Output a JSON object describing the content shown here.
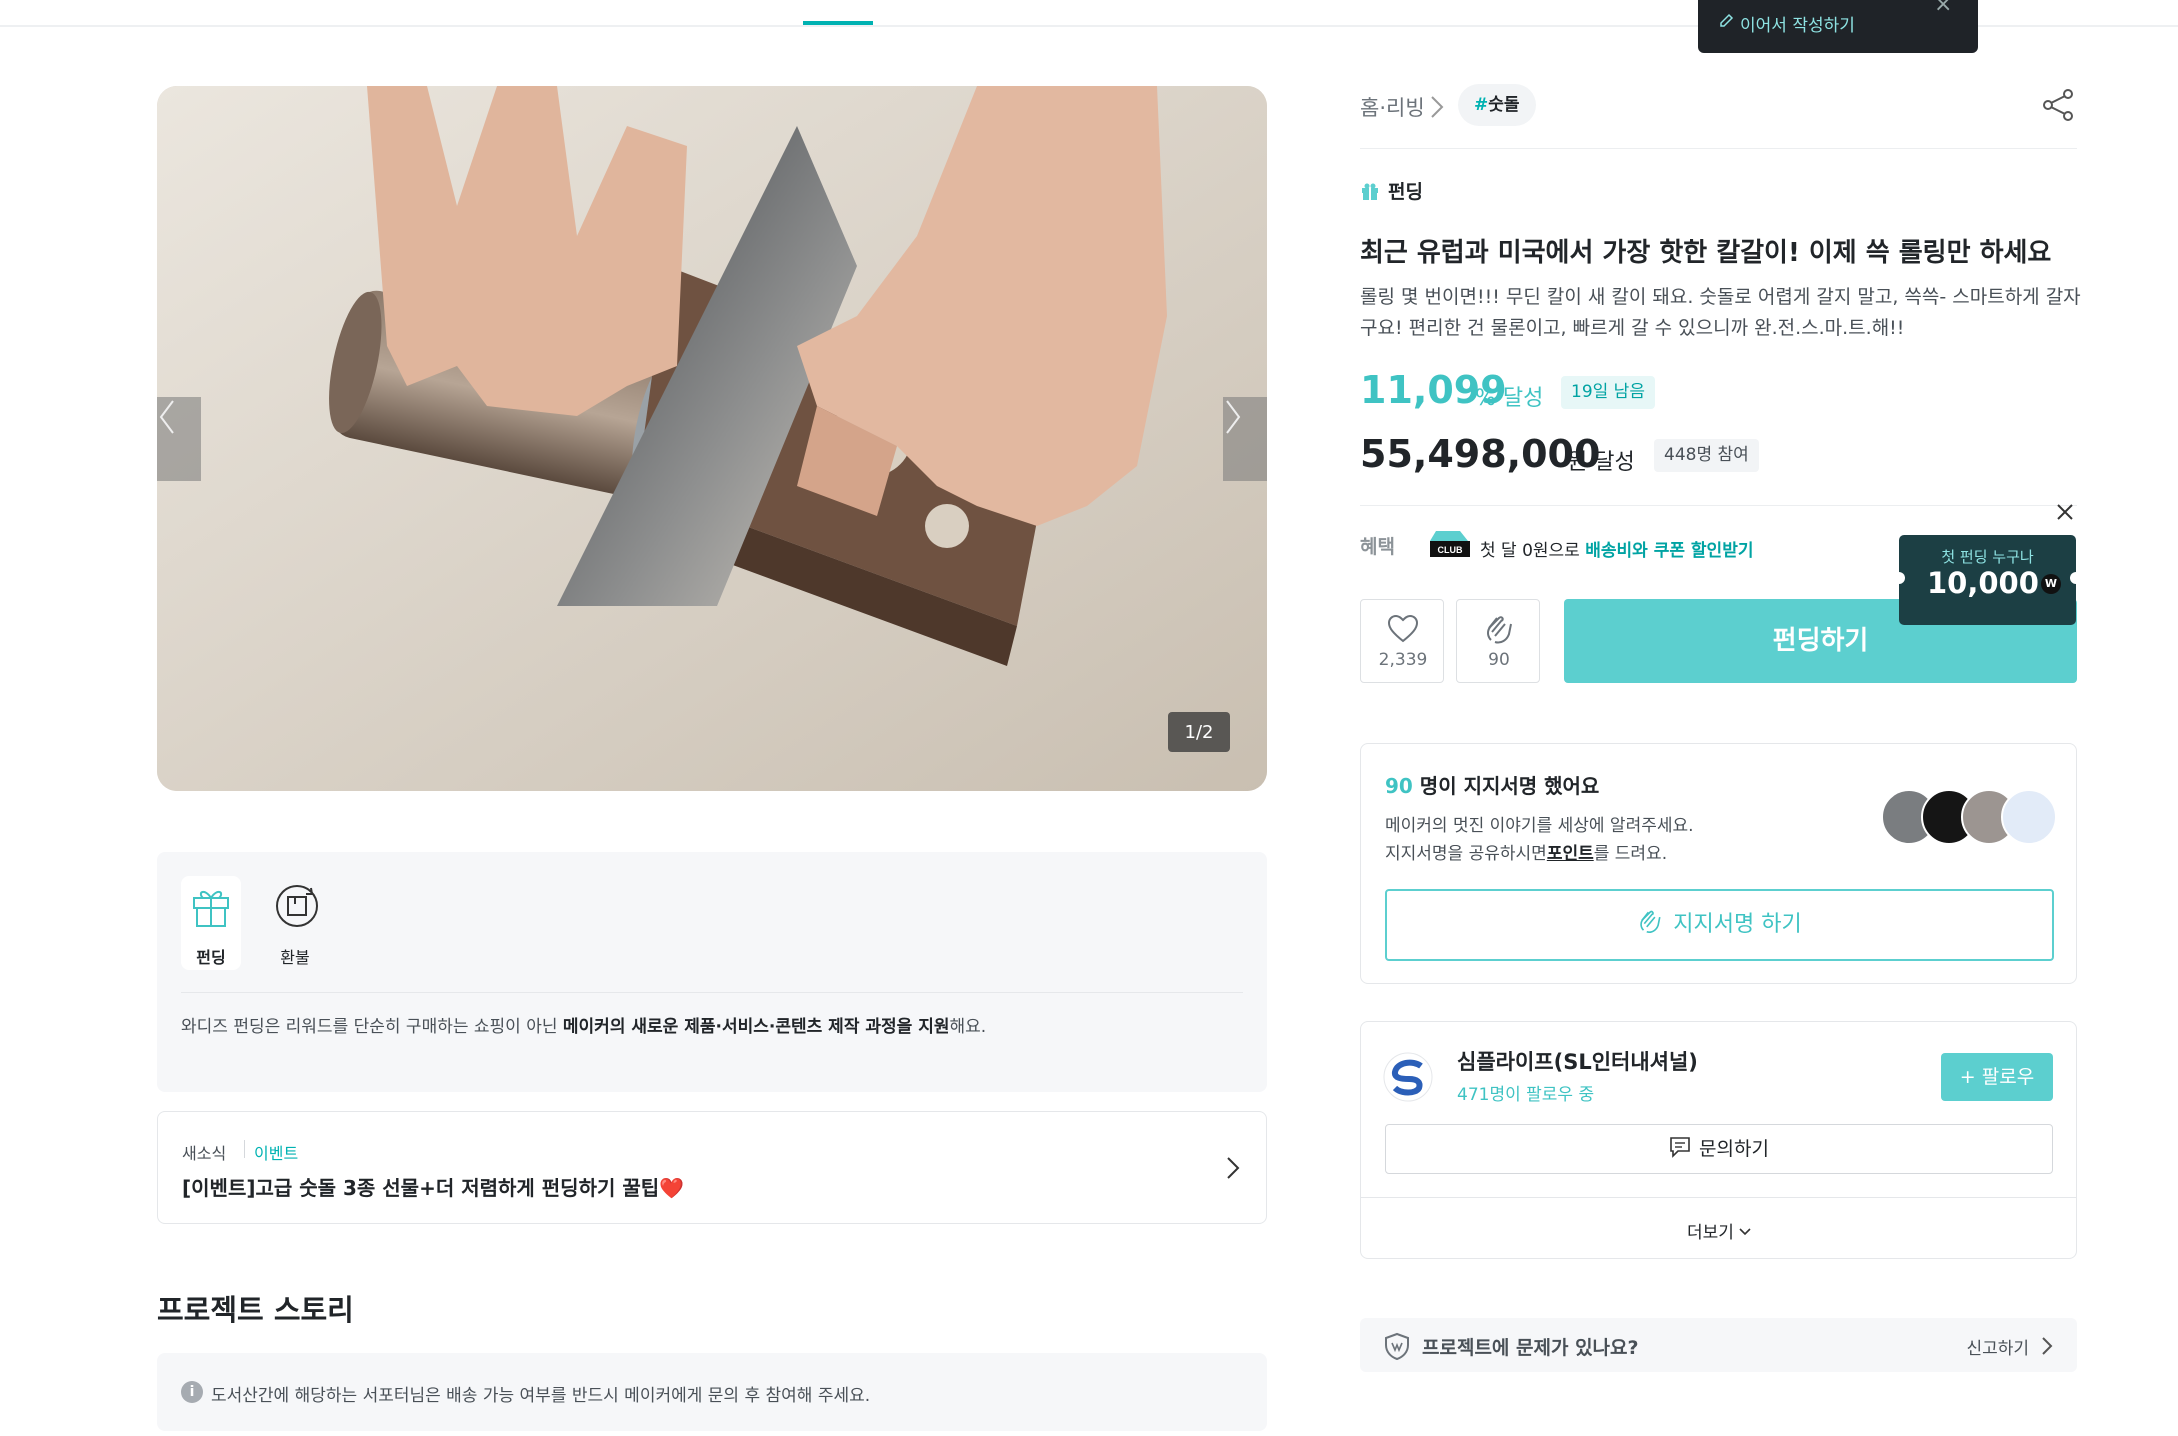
{
  "draft_popup": {
    "label": "이어서 작성하기"
  },
  "gallery": {
    "counter": "1/2"
  },
  "info_tabs": [
    {
      "label": "펀딩",
      "icon": "gift-icon"
    },
    {
      "label": "환불",
      "icon": "refund-icon"
    }
  ],
  "info_text": {
    "prefix": "와디즈 펀딩은 리워드를 단순히 구매하는 쇼핑이 아닌 ",
    "bold": "메이커의 새로운 제품·서비스·콘텐츠 제작 과정을 지원",
    "suffix": "해요."
  },
  "news": {
    "category": "새소식",
    "tag": "이벤트",
    "title": "[이벤트]고급 숫돌 3종 선물+더 저렴하게 펀딩하기 꿀팁❤️"
  },
  "story": {
    "title": "프로젝트 스토리",
    "notice": "도서산간에 해당하는 서포터님은 배송 가능 여부를 반드시 메이커에게 문의 후 참여해 주세요."
  },
  "breadcrumb": {
    "category": "홈·리빙",
    "hashtag_symbol": "#",
    "hashtag": "숫돌"
  },
  "project": {
    "type_label": "펀딩",
    "title": "최근 유럽과 미국에서 가장 핫한 칼갈이! 이제 쓱 롤링만 하세요",
    "description": "롤링 몇 번이면!!! 무딘 칼이 새 칼이 돼요. 숫돌로 어렵게 갈지 말고, 쓱쓱- 스마트하게 갈자구요! 편리한 건 물론이고, 빠르게 갈 수 있으니까 완.전.스.마.트.해!!",
    "percent": "11,099",
    "percent_unit": "% 달성",
    "days_left": "19일 남음",
    "amount": "55,498,000",
    "amount_unit": "원 달성",
    "supporters": "448명 참여"
  },
  "benefit": {
    "label": "혜택",
    "club_logo": "CLUB",
    "text_prefix": "첫 달 0원으로 ",
    "text_highlight": "배송비와 쿠폰 할인받기"
  },
  "actions": {
    "like_count": "2,339",
    "clap_count": "90",
    "fund_label": "펀딩하기"
  },
  "promo": {
    "small": "첫 펀딩 누구나",
    "big": "10,000",
    "coin": "W"
  },
  "sign": {
    "count": "90",
    "title_suffix": " 명이 지지서명 했어요",
    "desc_line1": "메이커의 멋진 이야기를 세상에 알려주세요.",
    "desc_line2_prefix": "지지서명을 공유하시면",
    "desc_line2_bold": "포인트",
    "desc_line2_suffix": "를 드려요.",
    "button": "지지서명 하기"
  },
  "maker": {
    "name": "심플라이프(SL인터내셔널)",
    "followers": "471명이 팔로우 중",
    "follow_button": "팔로우",
    "follow_plus": "+",
    "inquiry_button": "문의하기",
    "more_button": "더보기"
  },
  "report": {
    "text": "프로젝트에 문제가 있나요?",
    "link": "신고하기"
  },
  "colors": {
    "accent": "#00b2b2",
    "fund_button": "#5ccfcf",
    "promo_bg": "#1c3f44"
  }
}
